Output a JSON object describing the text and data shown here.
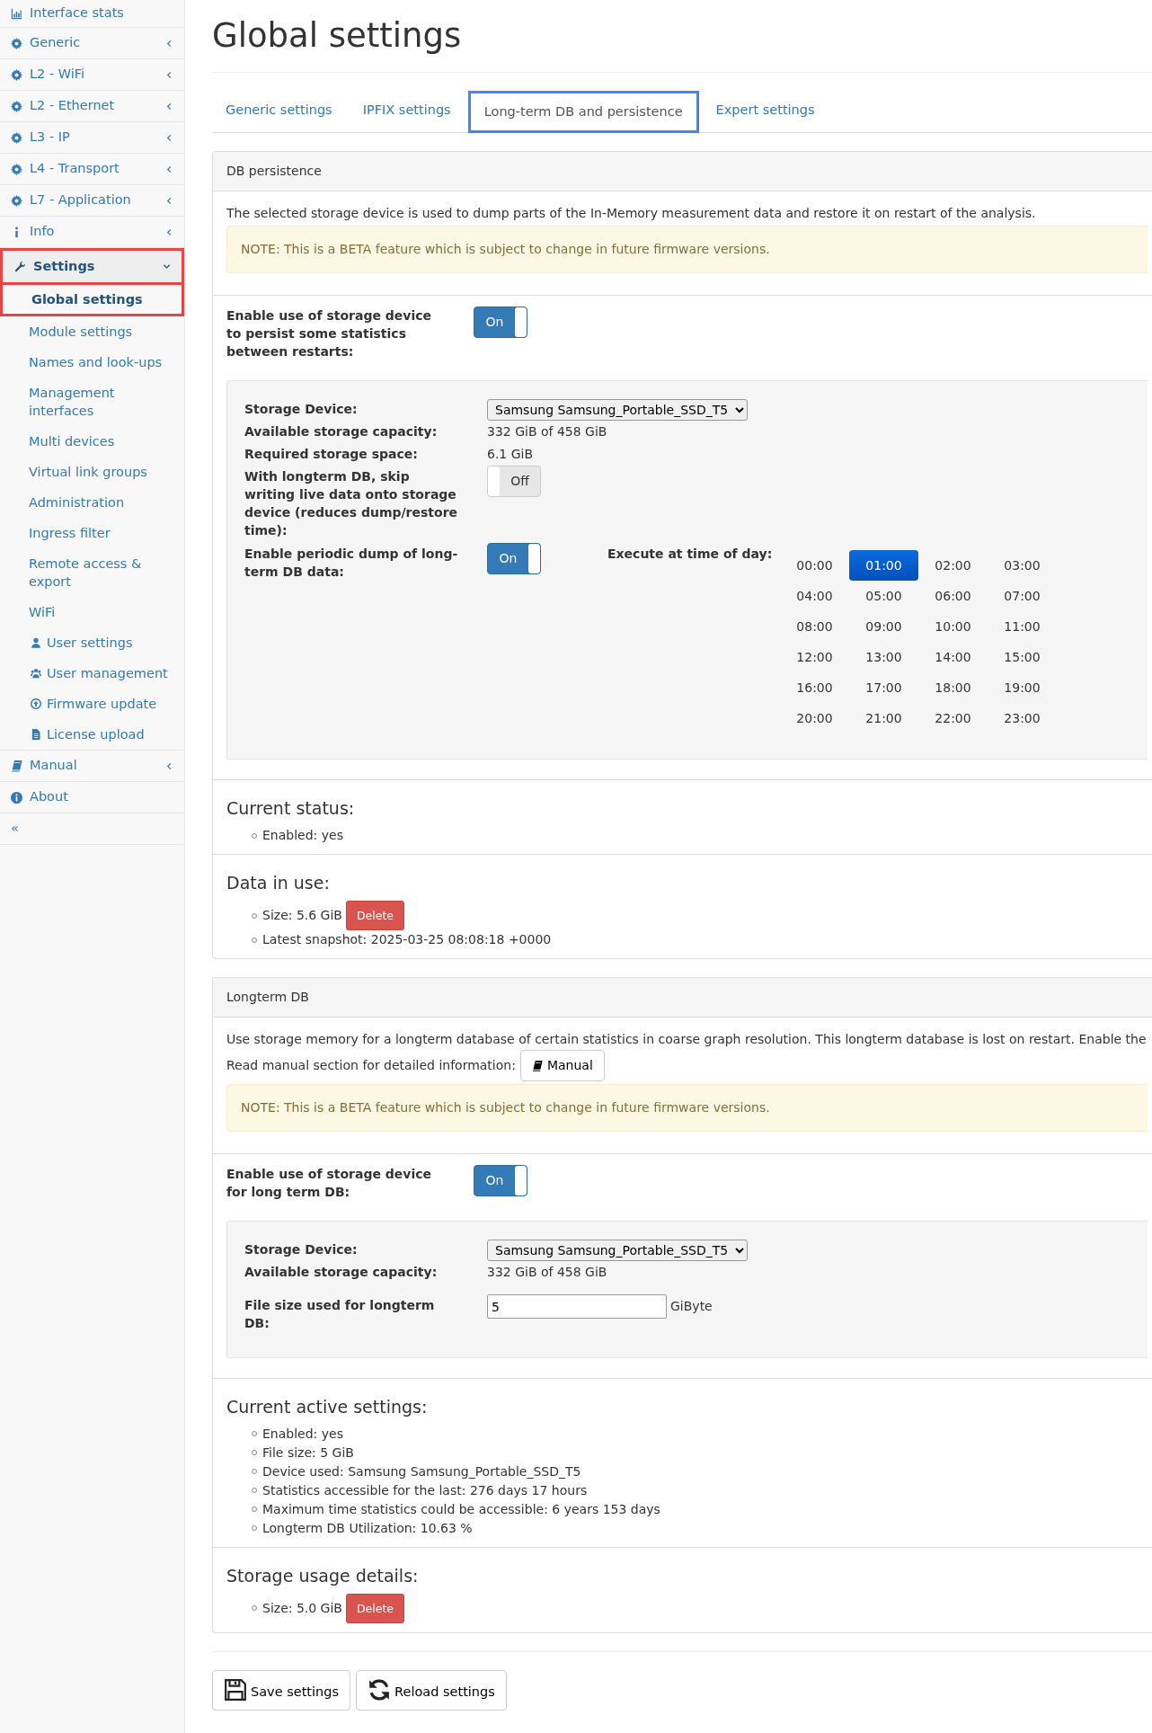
{
  "sidebar": {
    "items": [
      {
        "label": "Interface stats",
        "kind": "chart",
        "expandable": false,
        "selected": false
      },
      {
        "label": "Generic",
        "kind": "gear",
        "expandable": true,
        "expanded": false,
        "selected": false
      },
      {
        "label": "L2 - WiFi",
        "kind": "gear",
        "expandable": true,
        "expanded": false,
        "selected": false
      },
      {
        "label": "L2 - Ethernet",
        "kind": "gear",
        "expandable": true,
        "expanded": false,
        "selected": false
      },
      {
        "label": "L3 - IP",
        "kind": "gear",
        "expandable": true,
        "expanded": false,
        "selected": false
      },
      {
        "label": "L4 - Transport",
        "kind": "gear",
        "expandable": true,
        "expanded": false,
        "selected": false
      },
      {
        "label": "L7 - Application",
        "kind": "gear",
        "expandable": true,
        "expanded": false,
        "selected": false
      },
      {
        "label": "Info",
        "kind": "info",
        "expandable": true,
        "expanded": false,
        "selected": false
      },
      {
        "label": "Settings",
        "kind": "wrench",
        "expandable": true,
        "expanded": true,
        "selected": true,
        "children": [
          {
            "label": "Global settings",
            "selected": true
          },
          {
            "label": "Module settings",
            "selected": false
          },
          {
            "label": "Names and look-ups",
            "selected": false
          },
          {
            "label": "Management interfaces",
            "selected": false
          },
          {
            "label": "Multi devices",
            "selected": false
          },
          {
            "label": "Virtual link groups",
            "selected": false
          },
          {
            "label": "Administration",
            "selected": false
          },
          {
            "label": "Ingress filter",
            "selected": false
          },
          {
            "label": "Remote access & export",
            "selected": false
          },
          {
            "label": "WiFi",
            "selected": false
          },
          {
            "label": "User settings",
            "kind": "user",
            "selected": false
          },
          {
            "label": "User management",
            "kind": "users",
            "selected": false
          },
          {
            "label": "Firmware update",
            "kind": "upload",
            "selected": false
          },
          {
            "label": "License upload",
            "kind": "file",
            "selected": false
          }
        ]
      },
      {
        "label": "Manual",
        "kind": "book",
        "expandable": true,
        "expanded": false,
        "selected": false
      },
      {
        "label": "About",
        "kind": "info-circle",
        "expandable": false,
        "selected": false
      }
    ],
    "collapse": "«"
  },
  "title": "Global settings",
  "tabs": [
    {
      "label": "Generic settings",
      "selected": false
    },
    {
      "label": "IPFIX settings",
      "selected": false
    },
    {
      "label": "Long-term DB and persistence",
      "selected": true
    },
    {
      "label": "Expert settings",
      "selected": false
    }
  ],
  "panels": [
    {
      "title": "DB persistence",
      "description": [
        "The selected storage device is used to dump parts of the In-Memory measurement data and restore it on restart of the analysis."
      ],
      "note": "NOTE: This is a BETA feature which is subject to change in future firmware versions.",
      "enable": {
        "label": "Enable use of storage device to persist some statistics between restarts:",
        "on": true,
        "text": "On"
      },
      "fields": [
        {
          "kind": "select",
          "label": "Storage Device:",
          "value": "Samsung Samsung_Portable_SSD_T5"
        },
        {
          "kind": "text",
          "label": "Available storage capacity:",
          "value": "332 GiB of 458 GiB"
        },
        {
          "kind": "text",
          "label": "Required storage space:",
          "value": "6.1 GiB"
        },
        {
          "kind": "toggle",
          "label": "With longterm DB, skip writing live data onto storage device (reduces dump/restore time):",
          "on": false,
          "text": "Off"
        },
        {
          "kind": "schedule",
          "label": "Enable periodic dump of long-term DB data:",
          "on": true,
          "text": "On",
          "time_label": "Execute at time of day:",
          "times": [
            {
              "label": "00:00",
              "selected": false
            },
            {
              "label": "01:00",
              "selected": true
            },
            {
              "label": "02:00",
              "selected": false
            },
            {
              "label": "03:00",
              "selected": false
            },
            {
              "label": "04:00",
              "selected": false
            },
            {
              "label": "05:00",
              "selected": false
            },
            {
              "label": "06:00",
              "selected": false
            },
            {
              "label": "07:00",
              "selected": false
            },
            {
              "label": "08:00",
              "selected": false
            },
            {
              "label": "09:00",
              "selected": false
            },
            {
              "label": "10:00",
              "selected": false
            },
            {
              "label": "11:00",
              "selected": false
            },
            {
              "label": "12:00",
              "selected": false
            },
            {
              "label": "13:00",
              "selected": false
            },
            {
              "label": "14:00",
              "selected": false
            },
            {
              "label": "15:00",
              "selected": false
            },
            {
              "label": "16:00",
              "selected": false
            },
            {
              "label": "17:00",
              "selected": false
            },
            {
              "label": "18:00",
              "selected": false
            },
            {
              "label": "19:00",
              "selected": false
            },
            {
              "label": "20:00",
              "selected": false
            },
            {
              "label": "21:00",
              "selected": false
            },
            {
              "label": "22:00",
              "selected": false
            },
            {
              "label": "23:00",
              "selected": false
            }
          ]
        }
      ],
      "sections": [
        {
          "heading": "Current status:",
          "items": [
            {
              "text": "Enabled: yes"
            }
          ]
        },
        {
          "heading": "Data in use:",
          "items": [
            {
              "text": "Size: 5.6 GiB",
              "button": "Delete"
            },
            {
              "text": "Latest snapshot: 2025-03-25 08:08:18 +0000"
            }
          ]
        }
      ]
    },
    {
      "title": "Longterm DB",
      "description": [
        "Use storage memory for a longterm database of certain statistics in coarse graph resolution. This longterm database is lost on restart. Enable the"
      ],
      "manual": {
        "text": "Read manual section for detailed information:",
        "button": "Manual"
      },
      "note": "NOTE: This is a BETA feature which is subject to change in future firmware versions.",
      "enable": {
        "label": "Enable use of storage device for long term DB:",
        "on": true,
        "text": "On"
      },
      "fields": [
        {
          "kind": "select",
          "label": "Storage Device:",
          "value": "Samsung Samsung_Portable_SSD_T5"
        },
        {
          "kind": "text",
          "label": "Available storage capacity:",
          "value": "332 GiB of 458 GiB"
        },
        {
          "kind": "number",
          "label": "File size used for longterm DB:",
          "value": "5",
          "unit": "GiByte"
        }
      ],
      "sections": [
        {
          "heading": "Current active settings:",
          "items": [
            {
              "text": "Enabled: yes"
            },
            {
              "text": "File size: 5 GiB"
            },
            {
              "text": "Device used: Samsung Samsung_Portable_SSD_T5"
            },
            {
              "text": "Statistics accessible for the last: 276 days 17 hours"
            },
            {
              "text": "Maximum time statistics could be accessible: 6 years 153 days"
            },
            {
              "text": "Longterm DB Utilization: 10.63 %"
            }
          ]
        },
        {
          "heading": "Storage usage details:",
          "items": [
            {
              "text": "Size: 5.0 GiB",
              "button": "Delete"
            }
          ]
        }
      ]
    }
  ],
  "actions": [
    {
      "label": "Save settings",
      "kind": "save"
    },
    {
      "label": "Reload settings",
      "kind": "reload"
    }
  ]
}
